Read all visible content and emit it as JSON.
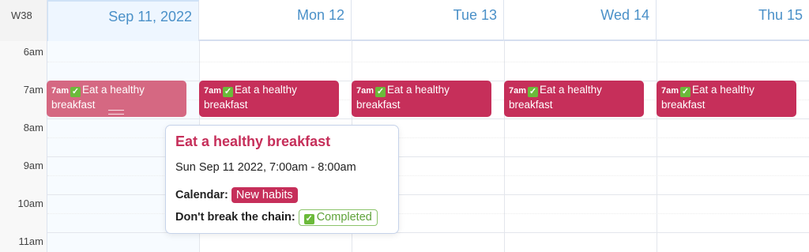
{
  "header": {
    "week": "W38",
    "days": [
      "Sep 11, 2022",
      "Mon 12",
      "Tue 13",
      "Wed 14",
      "Thu 15"
    ]
  },
  "hours": [
    "6am",
    "7am",
    "8am",
    "9am",
    "10am",
    "11am"
  ],
  "event": {
    "time": "7am",
    "check": "✓",
    "title": "Eat a healthy breakfast",
    "line1": "Eat a healthy",
    "line2": "breakfast"
  },
  "popup": {
    "title": "Eat a healthy breakfast",
    "date": "Sun Sep 11 2022, 7:00am - 8:00am",
    "calendar_label": "Calendar:",
    "calendar_value": "New habits",
    "chain_label": "Don't break the chain:",
    "chain_value": "Completed"
  },
  "colors": {
    "event": "#c62f5a",
    "event_selected": "#d56882",
    "accent": "#4a90c8",
    "success": "#6bba3a"
  }
}
